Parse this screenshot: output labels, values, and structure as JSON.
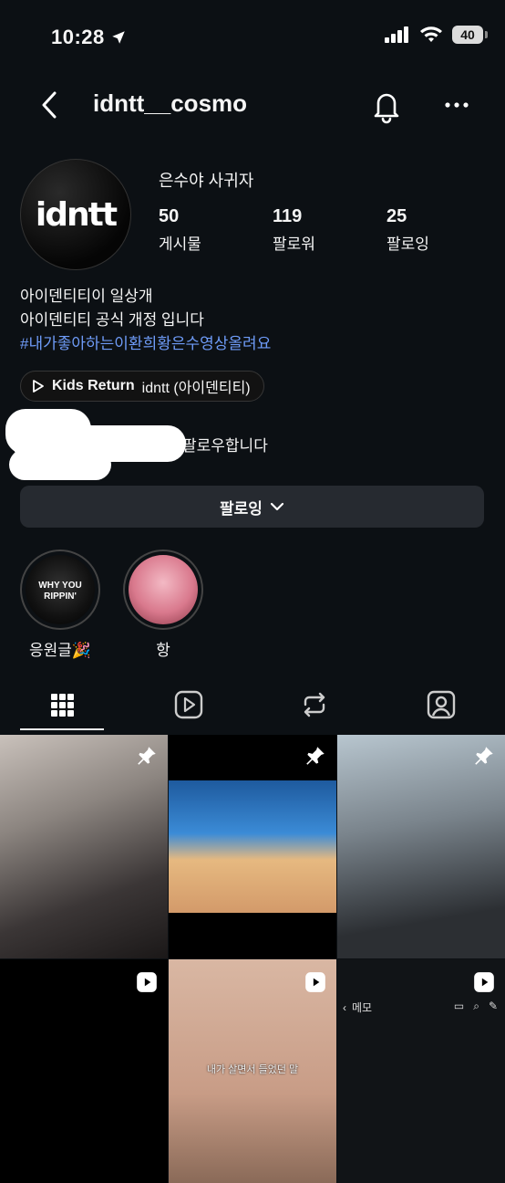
{
  "status_bar": {
    "time": "10:28",
    "battery": "40"
  },
  "header": {
    "username": "idntt__cosmo"
  },
  "profile": {
    "avatar_text": "idntt",
    "display_name": "은수야 사귀자",
    "stats": [
      {
        "number": "50",
        "label": "게시물"
      },
      {
        "number": "119",
        "label": "팔로워"
      },
      {
        "number": "25",
        "label": "팔로잉"
      }
    ],
    "bio_lines": [
      "아이덴티티이 일상개",
      "아이덴티티 공식 개정 입니다"
    ],
    "hashtag": "#내가좋아하는이환희황은수영상올려요",
    "music": {
      "song": "Kids Return",
      "artist": "idntt (아이덴티티)"
    },
    "followed_by_suffix": "팔로우합니다"
  },
  "follow_button": {
    "label": "팔로잉"
  },
  "highlights": [
    {
      "label": "응원글🎉",
      "cover_text": "WHY YOU RIPPIN'"
    },
    {
      "label": "항"
    }
  ],
  "tabs": [
    "grid",
    "reels",
    "reposts",
    "tagged"
  ],
  "grid_posts": [
    {
      "type": "photo",
      "pinned": true
    },
    {
      "type": "photo",
      "pinned": true
    },
    {
      "type": "photo",
      "pinned": true
    },
    {
      "type": "reel"
    },
    {
      "type": "reel",
      "subtitle": "내가 살면서 들었던 말"
    },
    {
      "type": "reel",
      "memo_label": "메모"
    }
  ]
}
